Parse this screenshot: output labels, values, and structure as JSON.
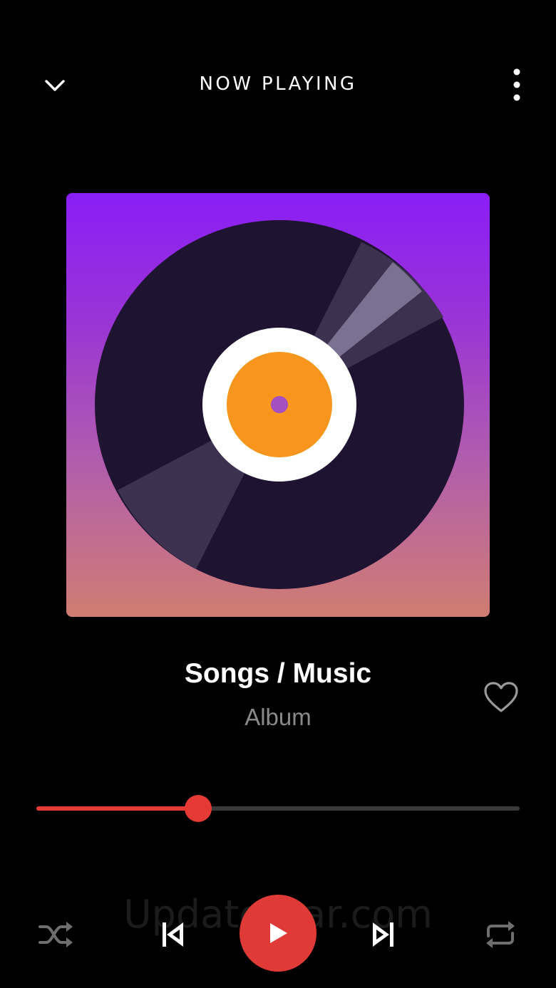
{
  "header": {
    "title": "NOW PLAYING",
    "collapse_icon": "chevron-down-icon",
    "menu_icon": "more-vertical-icon"
  },
  "artwork": {
    "icon": "vinyl-record-icon",
    "colors": {
      "gradient_top": "#8a1ef6",
      "gradient_bottom": "#cf7d70",
      "disc": "#1e1330",
      "label_ring": "#ffffff",
      "label_center": "#f7951d",
      "spindle": "#a34fc2"
    }
  },
  "track": {
    "title": "Songs / Music",
    "album": "Album",
    "favorite_icon": "heart-outline-icon"
  },
  "progress": {
    "fraction": 0.335,
    "accent": "#e53935"
  },
  "watermark": "UpdateStar.com",
  "controls": {
    "shuffle_icon": "shuffle-icon",
    "previous_icon": "skip-previous-icon",
    "play_icon": "play-icon",
    "next_icon": "skip-next-icon",
    "repeat_icon": "repeat-icon",
    "play_color": "#e03a37"
  }
}
